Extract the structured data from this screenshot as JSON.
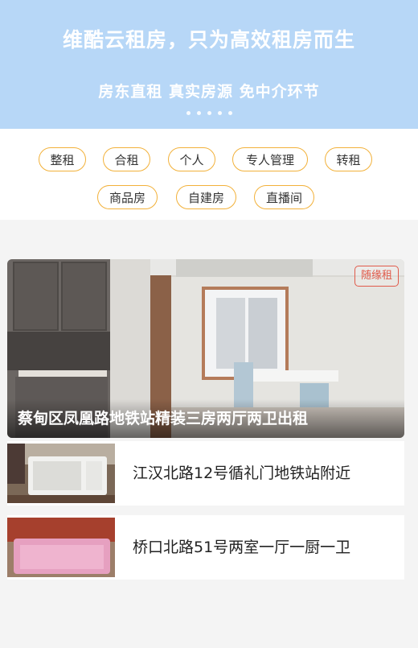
{
  "banner": {
    "title": "维酷云租房，只为高效租房而生",
    "subtitle": "房东直租 真实房源 免中介环节",
    "dot_count": 5
  },
  "tags": [
    "整租",
    "合租",
    "个人",
    "专人管理",
    "转租",
    "商品房",
    "自建房",
    "直播间"
  ],
  "featured": {
    "title": "蔡甸区凤凰路地铁站精装三房两厅两卫出租",
    "badge": "随缘租"
  },
  "listings": [
    {
      "title": "江汉北路12号循礼门地铁站附近"
    },
    {
      "title": "桥口北路51号两室一厅一厨一卫"
    }
  ],
  "colors": {
    "banner": "#b7d7f7",
    "tag_border": "#f2b13a",
    "badge": "#e05a4a"
  }
}
